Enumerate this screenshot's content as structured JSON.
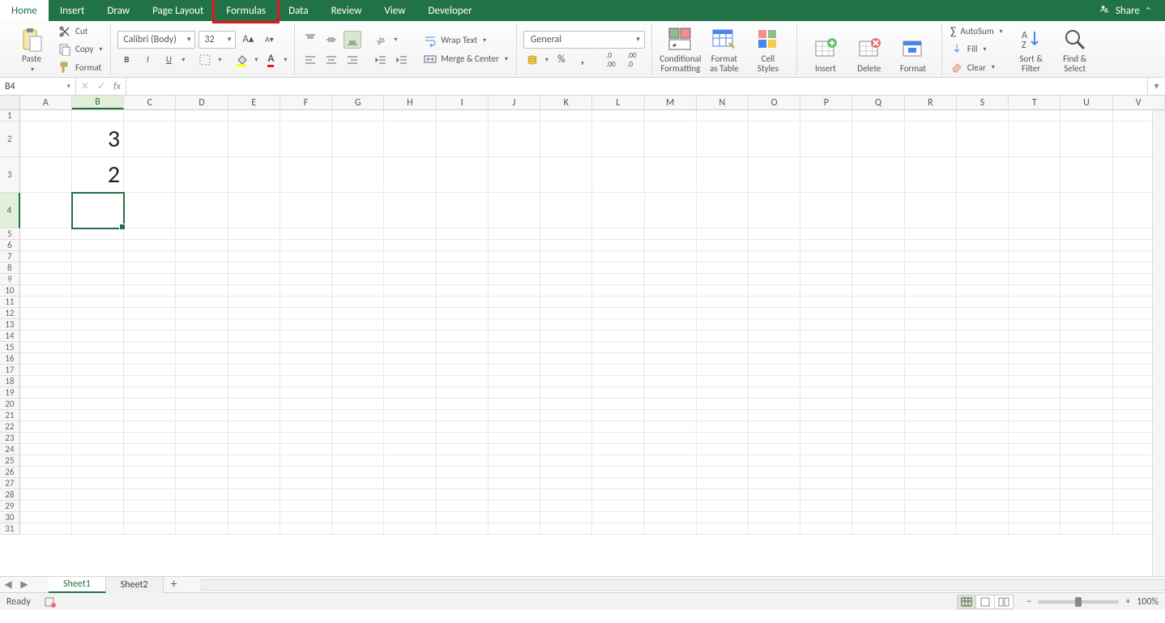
{
  "tabs": {
    "items": [
      "Home",
      "Insert",
      "Draw",
      "Page Layout",
      "Formulas",
      "Data",
      "Review",
      "View",
      "Developer"
    ],
    "active": "Home",
    "highlighted": "Formulas",
    "share_label": "Share"
  },
  "ribbon": {
    "clipboard": {
      "paste": "Paste",
      "cut": "Cut",
      "copy": "Copy",
      "format": "Format"
    },
    "font": {
      "name": "Calibri (Body)",
      "size": "32",
      "bold": "B",
      "italic": "I",
      "underline": "U"
    },
    "alignment": {
      "wrap": "Wrap Text",
      "merge": "Merge & Center"
    },
    "number": {
      "format": "General"
    },
    "styles": {
      "cond": "Conditional\nFormatting",
      "fmttable": "Format\nas Table",
      "cellstyles": "Cell\nStyles"
    },
    "cells": {
      "insert": "Insert",
      "delete": "Delete",
      "format": "Format"
    },
    "editing": {
      "autosum": "AutoSum",
      "fill": "Fill",
      "clear": "Clear",
      "sortfilter": "Sort &\nFilter",
      "findselect": "Find &\nSelect"
    }
  },
  "formula_bar": {
    "namebox": "B4",
    "cancel": "✕",
    "enter": "✓",
    "fx": "fx",
    "formula": ""
  },
  "grid": {
    "columns": [
      "A",
      "B",
      "C",
      "D",
      "E",
      "F",
      "G",
      "H",
      "I",
      "J",
      "K",
      "L",
      "M",
      "N",
      "O",
      "P",
      "Q",
      "R",
      "S",
      "T",
      "U",
      "V"
    ],
    "selected_col": "B",
    "selected_row": 4,
    "rows": [
      {
        "n": 1,
        "tall": false,
        "cells": {}
      },
      {
        "n": 2,
        "tall": true,
        "cells": {
          "B": "3"
        }
      },
      {
        "n": 3,
        "tall": true,
        "cells": {
          "B": "2"
        }
      },
      {
        "n": 4,
        "tall": true,
        "cells": {}
      },
      {
        "n": 5,
        "tall": false,
        "cells": {}
      },
      {
        "n": 6,
        "tall": false,
        "cells": {}
      },
      {
        "n": 7,
        "tall": false,
        "cells": {}
      },
      {
        "n": 8,
        "tall": false,
        "cells": {}
      },
      {
        "n": 9,
        "tall": false,
        "cells": {}
      },
      {
        "n": 10,
        "tall": false,
        "cells": {}
      },
      {
        "n": 11,
        "tall": false,
        "cells": {}
      },
      {
        "n": 12,
        "tall": false,
        "cells": {}
      },
      {
        "n": 13,
        "tall": false,
        "cells": {}
      },
      {
        "n": 14,
        "tall": false,
        "cells": {}
      },
      {
        "n": 15,
        "tall": false,
        "cells": {}
      },
      {
        "n": 16,
        "tall": false,
        "cells": {}
      },
      {
        "n": 17,
        "tall": false,
        "cells": {}
      },
      {
        "n": 18,
        "tall": false,
        "cells": {}
      },
      {
        "n": 19,
        "tall": false,
        "cells": {}
      },
      {
        "n": 20,
        "tall": false,
        "cells": {}
      },
      {
        "n": 21,
        "tall": false,
        "cells": {}
      },
      {
        "n": 22,
        "tall": false,
        "cells": {}
      },
      {
        "n": 23,
        "tall": false,
        "cells": {}
      },
      {
        "n": 24,
        "tall": false,
        "cells": {}
      },
      {
        "n": 25,
        "tall": false,
        "cells": {}
      },
      {
        "n": 26,
        "tall": false,
        "cells": {}
      },
      {
        "n": 27,
        "tall": false,
        "cells": {}
      },
      {
        "n": 28,
        "tall": false,
        "cells": {}
      },
      {
        "n": 29,
        "tall": false,
        "cells": {}
      },
      {
        "n": 30,
        "tall": false,
        "cells": {}
      },
      {
        "n": 31,
        "tall": false,
        "cells": {}
      }
    ]
  },
  "sheets": {
    "items": [
      "Sheet1",
      "Sheet2"
    ],
    "active": "Sheet1",
    "add": "+"
  },
  "status": {
    "ready": "Ready",
    "zoom": "100%",
    "minus": "−",
    "plus": "+"
  }
}
